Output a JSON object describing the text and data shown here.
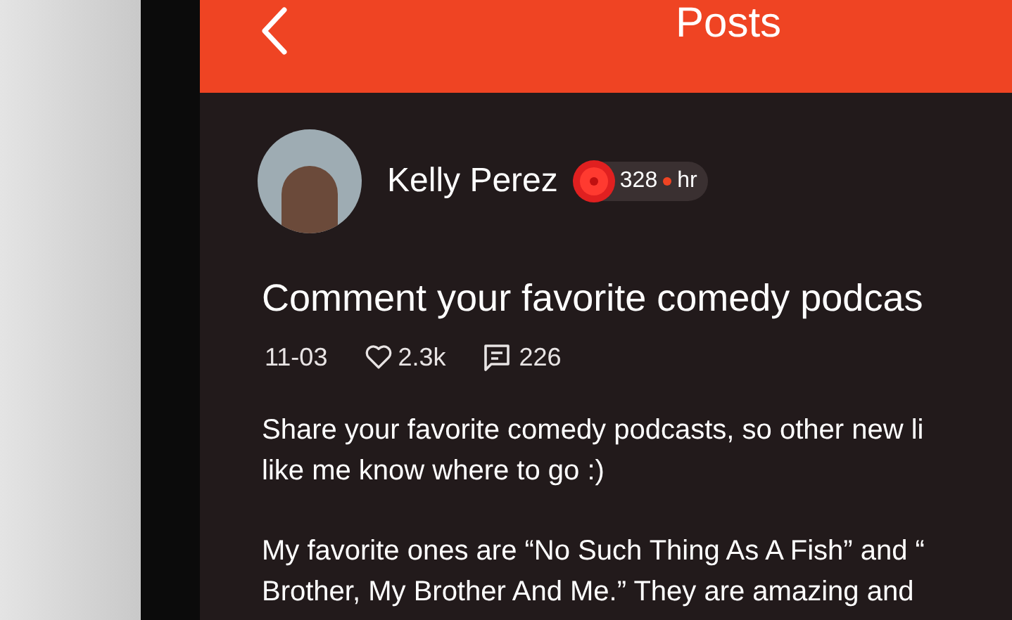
{
  "header": {
    "title": "Posts"
  },
  "post": {
    "author": "Kelly Perez",
    "badge": {
      "count": "328",
      "unit": "hr"
    },
    "title": "Comment your favorite comedy podcas",
    "date": "11-03",
    "likes": "2.3k",
    "comments": "226",
    "paragraphs": [
      [
        "Share your favorite comedy podcasts, so other new li",
        "like me know where to go :)"
      ],
      [
        "My favorite ones are “No Such Thing As A Fish” and “",
        "Brother, My Brother And Me.” They are amazing and"
      ]
    ]
  }
}
